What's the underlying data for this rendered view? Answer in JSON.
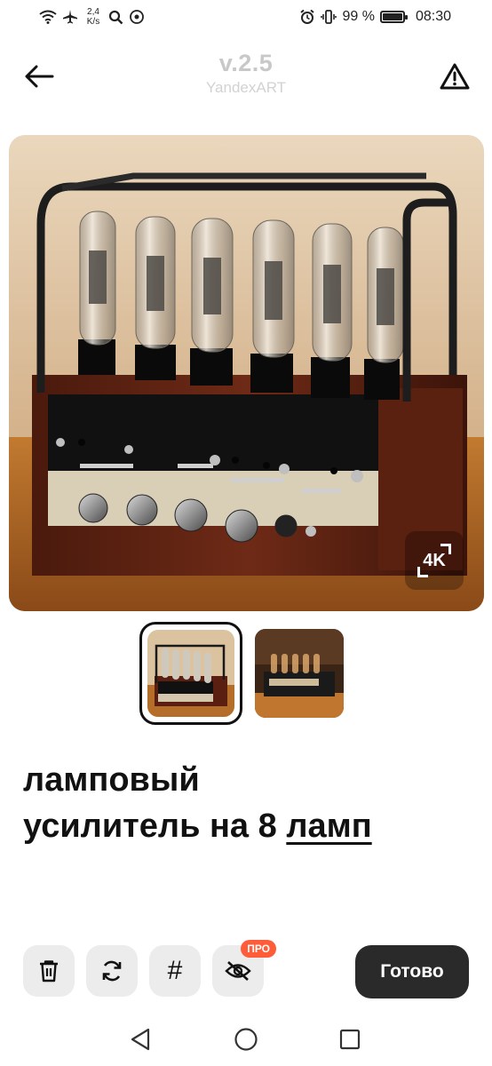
{
  "status": {
    "net_speed_value": "2,4",
    "net_speed_unit": "K/s",
    "battery_percent": "99 %",
    "battery_level": 0.99,
    "time": "08:30"
  },
  "header": {
    "version": "v.2.5",
    "model": "YandexART"
  },
  "image": {
    "badge_label": "4K"
  },
  "thumbnails": {
    "count": 2,
    "selected_index": 0
  },
  "prompt": {
    "line1": "ламповый",
    "line2": "усилитель на 8",
    "highlight": "ламп"
  },
  "toolbar": {
    "delete_icon": "trash-icon",
    "regenerate_icon": "refresh-icon",
    "hashtag_label": "#",
    "hide_icon": "eye-off-icon",
    "pro_badge": "ПРО",
    "done_label": "Готово"
  },
  "colors": {
    "done_bg": "#2a2a2a",
    "pro_badge": "#ff5c3a",
    "tool_bg": "#ececec"
  }
}
